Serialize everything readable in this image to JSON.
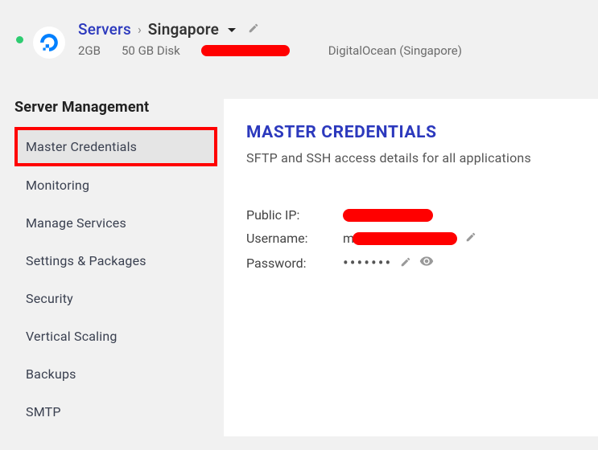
{
  "header": {
    "breadcrumb_root": "Servers",
    "breadcrumb_current": "Singapore",
    "ram": "2GB",
    "disk": "50 GB Disk",
    "provider": "DigitalOcean (Singapore)"
  },
  "sidebar": {
    "title": "Server Management",
    "items": [
      {
        "label": "Master Credentials"
      },
      {
        "label": "Monitoring"
      },
      {
        "label": "Manage Services"
      },
      {
        "label": "Settings & Packages"
      },
      {
        "label": "Security"
      },
      {
        "label": "Vertical Scaling"
      },
      {
        "label": "Backups"
      },
      {
        "label": "SMTP"
      }
    ]
  },
  "panel": {
    "title": "MASTER CREDENTIALS",
    "subtitle": "SFTP and SSH access details for all applications",
    "public_ip_label": "Public IP:",
    "username_label": "Username:",
    "username_prefix": "m",
    "password_label": "Password:",
    "password_dots": "•••••••"
  }
}
